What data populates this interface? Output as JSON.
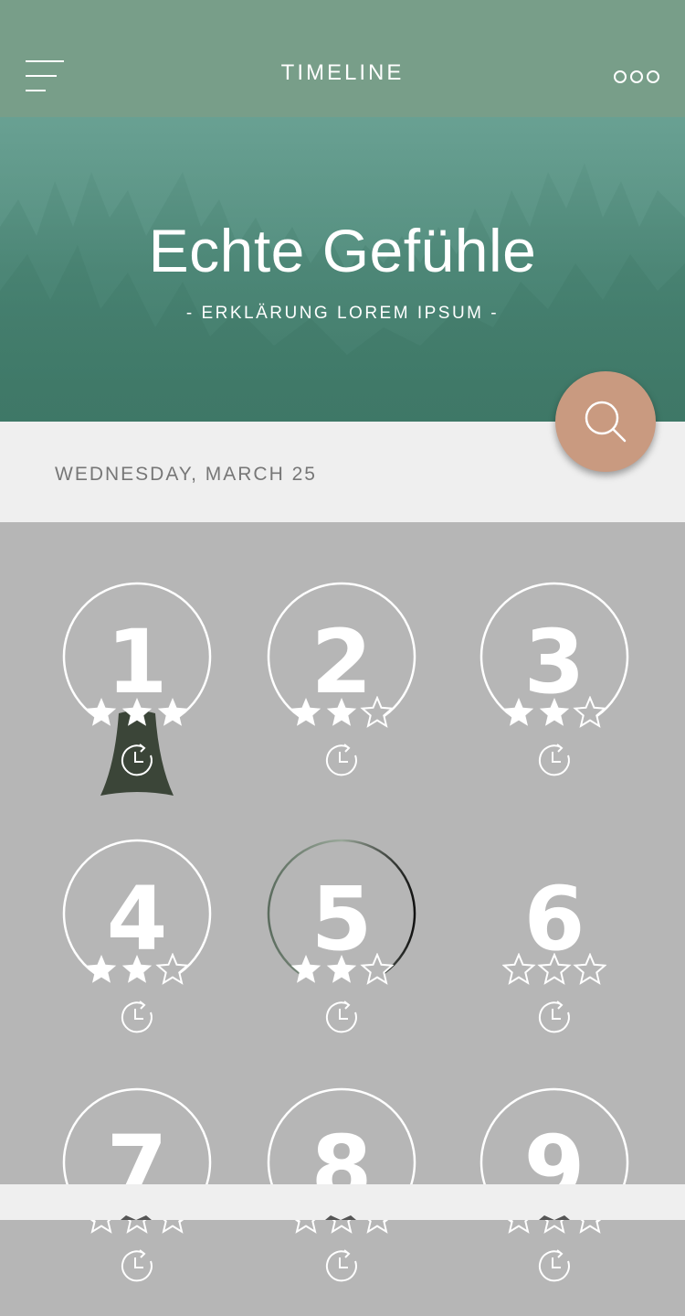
{
  "header": {
    "title": "TIMELINE",
    "menu_icon": "hamburger-icon",
    "more_icon": "more-dots-icon"
  },
  "hero": {
    "title": "Echte Gefühle",
    "subtitle": "- ERKLÄRUNG LOREM IPSUM -"
  },
  "date_label": "WEDNESDAY, MARCH 25",
  "search_button": {
    "icon": "search-icon"
  },
  "levels": [
    {
      "number": "1",
      "stars": 3,
      "ring": "partial",
      "active": true
    },
    {
      "number": "2",
      "stars": 2,
      "ring": "partial"
    },
    {
      "number": "3",
      "stars": 2,
      "ring": "partial"
    },
    {
      "number": "4",
      "stars": 2,
      "ring": "partial"
    },
    {
      "number": "5",
      "stars": 2,
      "ring": "progress"
    },
    {
      "number": "6",
      "stars": 0,
      "ring": "none"
    },
    {
      "number": "7",
      "stars": 0,
      "ring": "partial"
    },
    {
      "number": "8",
      "stars": 0,
      "ring": "partial"
    },
    {
      "number": "9",
      "stars": 0,
      "ring": "partial"
    }
  ],
  "colors": {
    "header": "#789e89",
    "hero": "#4f8a7a",
    "accent": "#c99a80",
    "grid_bg": "#b6b6b6",
    "ribbon": "#3b4538"
  }
}
